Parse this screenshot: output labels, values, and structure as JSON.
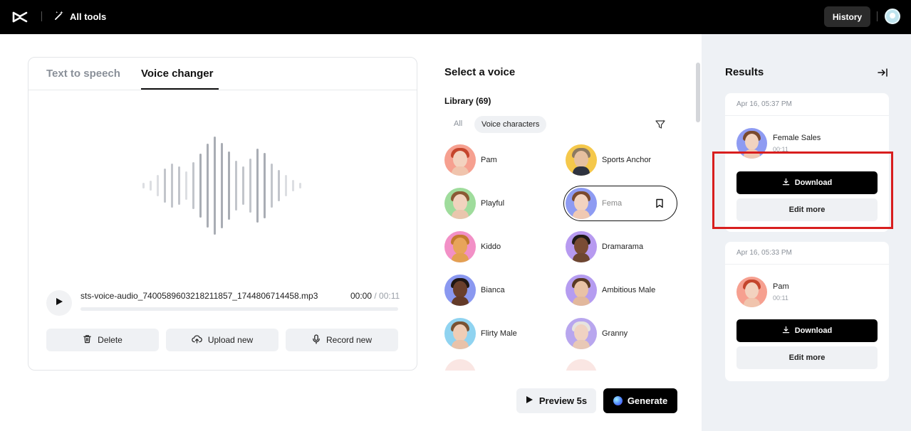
{
  "topbar": {
    "all_tools_label": "All tools",
    "history_label": "History"
  },
  "left_panel": {
    "tabs": [
      {
        "label": "Text to speech",
        "active": false
      },
      {
        "label": "Voice changer",
        "active": true
      }
    ],
    "audio": {
      "filename": "sts-voice-audio_7400589603218211857_1744806714458.mp3",
      "current_time": "00:00",
      "separator": " / ",
      "total_time": "00:11",
      "progress": 0
    },
    "actions": {
      "delete": "Delete",
      "upload": "Upload new",
      "record": "Record new"
    }
  },
  "voice_selector": {
    "title": "Select a voice",
    "library_label": "Library (69)",
    "filters": {
      "all": "All",
      "characters": "Voice characters"
    },
    "voices": [
      {
        "name": "Pam"
      },
      {
        "name": "Sports Anchor"
      },
      {
        "name": "Playful"
      },
      {
        "name": "Fema",
        "selected": true
      },
      {
        "name": "Kiddo"
      },
      {
        "name": "Dramarama"
      },
      {
        "name": "Bianca"
      },
      {
        "name": "Ambitious Male"
      },
      {
        "name": "Flirty Male"
      },
      {
        "name": "Granny"
      }
    ],
    "preview_label": "Preview 5s",
    "generate_label": "Generate"
  },
  "results": {
    "title": "Results",
    "items": [
      {
        "date": "Apr 16, 05:37 PM",
        "voice": "Female Sales",
        "duration": "00:11",
        "download_label": "Download",
        "edit_label": "Edit more"
      },
      {
        "date": "Apr 16, 05:33 PM",
        "voice": "Pam",
        "duration": "00:11",
        "download_label": "Download",
        "edit_label": "Edit more"
      }
    ]
  },
  "colors": {
    "accent": "#000000",
    "highlight": "#d81e1e",
    "panel_bg": "#eef1f5"
  }
}
